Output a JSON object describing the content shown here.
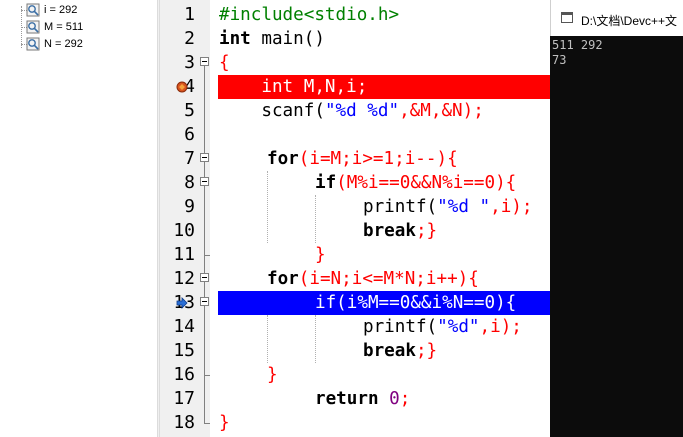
{
  "watch": {
    "items": [
      {
        "label": "i = 292"
      },
      {
        "label": "M = 511"
      },
      {
        "label": "N = 292"
      }
    ]
  },
  "editor": {
    "line_numbers": [
      "1",
      "2",
      "3",
      "4",
      "5",
      "6",
      "7",
      "8",
      "9",
      "10",
      "11",
      "12",
      "13",
      "14",
      "15",
      "16",
      "17",
      "18"
    ],
    "code": {
      "l1": "#include<stdio.h>",
      "l2_kw": "int",
      "l2_rest": " main()",
      "l3": "{",
      "l4": "    int M,N,i;",
      "l5_fn": "    scanf(",
      "l5_str": "\"%d %d\"",
      "l5_rest": ",&M,&N);",
      "l7_kw": "for",
      "l7_rest": "(i=M;i>=1;i--){",
      "l8_kw": "if",
      "l8_rest": "(M%i==0&&N%i==0){",
      "l9_fn": "printf(",
      "l9_str": "\"%d \"",
      "l9_rest": ",i);",
      "l10_kw": "break",
      "l10_rest": ";}",
      "l11": "}",
      "l12_kw": "for",
      "l12_rest": "(i=N;i<=M*N;i++){",
      "l13": "if(i%M==0&&i%N==0){",
      "l14_fn": "printf(",
      "l14_str": "\"%d\"",
      "l14_rest": ",i);",
      "l15_kw": "break",
      "l15_rest": ";}",
      "l16": "}",
      "l17_kw": "return",
      "l17_num": "0",
      "l17_rest": ";",
      "l18": "}"
    }
  },
  "console": {
    "title": "D:\\文档\\Devc++文",
    "output_line1": "511 292",
    "output_line2": "73"
  },
  "colors": {
    "breakpoint_line": "#ff0000",
    "exec_line": "#0000ff",
    "preprocessor": "#008000",
    "string": "#0000ff",
    "operator": "#ff0000",
    "number": "#800080"
  }
}
